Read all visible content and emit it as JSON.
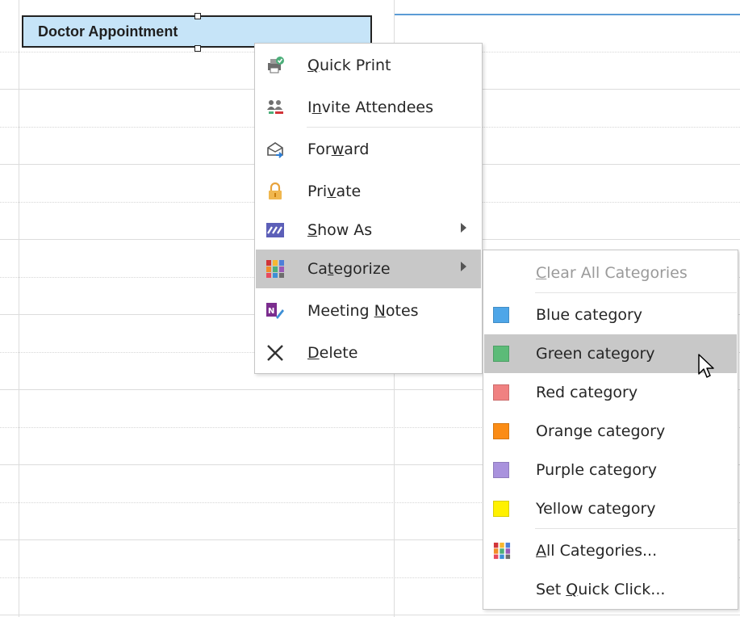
{
  "appointment": {
    "title": "Doctor Appointment"
  },
  "context_menu": {
    "items": [
      {
        "label": "Quick Print",
        "mnemonic_index": 0,
        "icon": "quick-print-icon"
      },
      {
        "label": "Invite Attendees",
        "mnemonic_index": 1,
        "icon": "invite-attendees-icon"
      },
      {
        "label": "Forward",
        "mnemonic_index": 3,
        "icon": "forward-icon"
      },
      {
        "label": "Private",
        "mnemonic_index": 3,
        "icon": "lock-icon"
      },
      {
        "label": "Show As",
        "mnemonic_index": 0,
        "icon": "show-as-icon",
        "submenu": true
      },
      {
        "label": "Categorize",
        "mnemonic_index": 2,
        "icon": "categorize-icon",
        "submenu": true,
        "active": true
      },
      {
        "label": "Meeting Notes",
        "mnemonic_index": 8,
        "icon": "onenote-icon"
      },
      {
        "label": "Delete",
        "mnemonic_index": 0,
        "icon": "delete-icon"
      }
    ]
  },
  "categorize_submenu": {
    "items": [
      {
        "label": "Clear All Categories",
        "mnemonic_index": 0,
        "disabled": true
      },
      {
        "label": "Blue category",
        "color": "#4ea6e8"
      },
      {
        "label": "Green category",
        "color": "#5cbb78",
        "hover": true
      },
      {
        "label": "Red category",
        "color": "#f08181"
      },
      {
        "label": "Orange category",
        "color": "#fb8c15"
      },
      {
        "label": "Purple category",
        "color": "#a992dd"
      },
      {
        "label": "Yellow category",
        "color": "#fff100"
      },
      {
        "label": "All Categories...",
        "mnemonic_index": 0,
        "icon": "categorize-icon"
      },
      {
        "label": "Set Quick Click...",
        "mnemonic_index": 4
      }
    ]
  },
  "colors": {
    "appointment_fill": "#c6e4f8",
    "menu_highlight": "#c8c8c8",
    "timebar_accent": "#5b9bd5"
  }
}
